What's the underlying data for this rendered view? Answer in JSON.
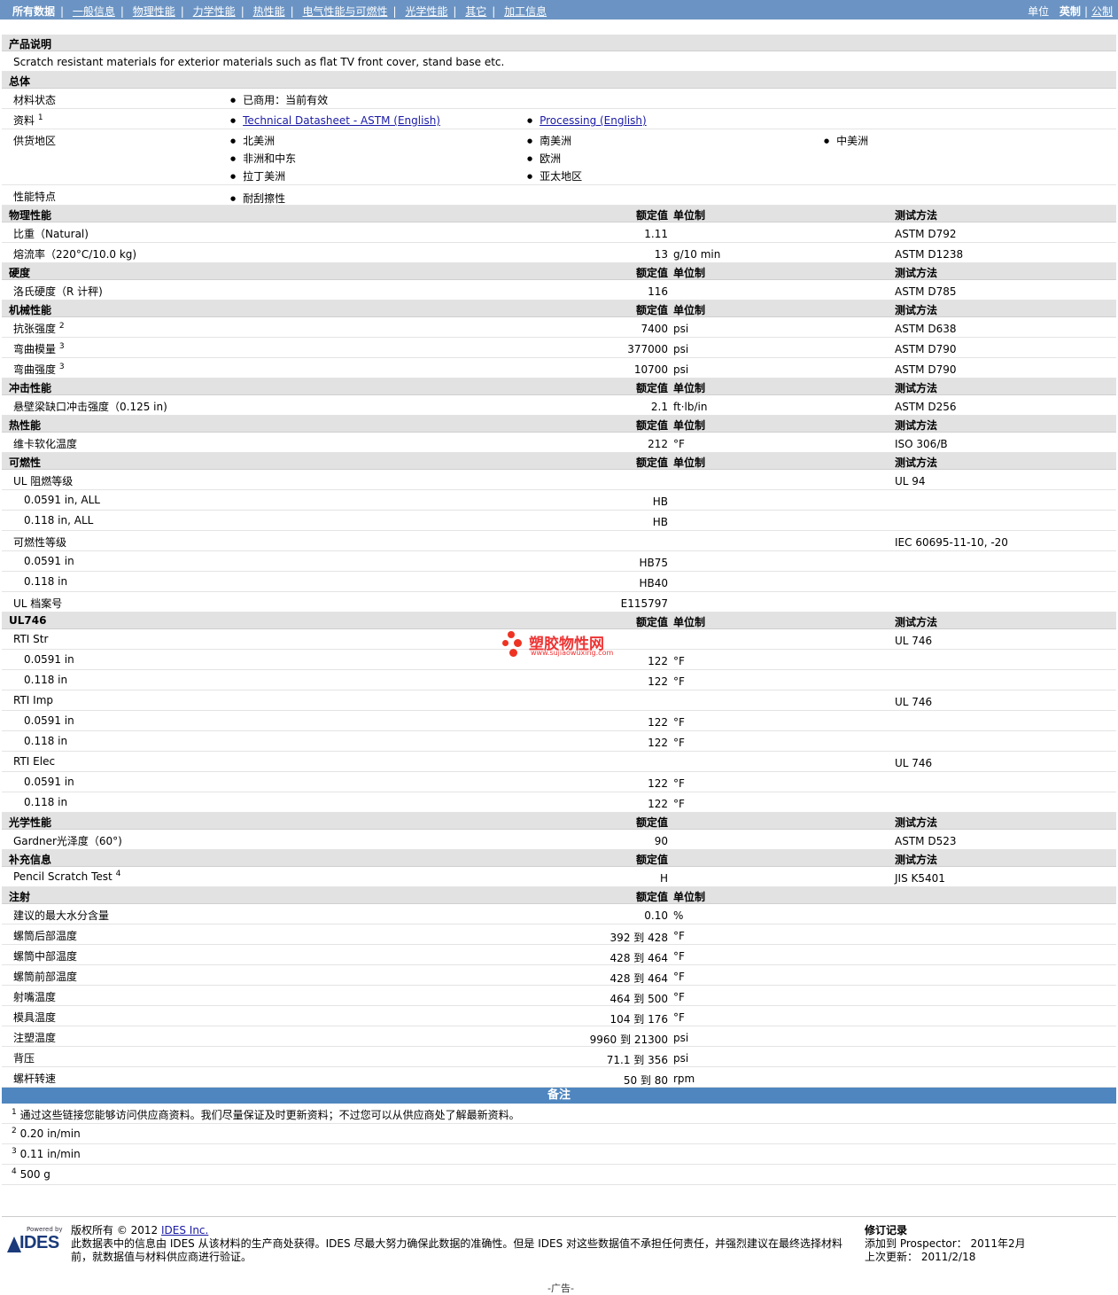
{
  "nav": {
    "tabs": [
      {
        "label": "所有数据"
      },
      {
        "label": "一般信息"
      },
      {
        "label": "物理性能"
      },
      {
        "label": "力学性能"
      },
      {
        "label": "热性能"
      },
      {
        "label": "电气性能与可燃性"
      },
      {
        "label": "光学性能"
      },
      {
        "label": "其它"
      },
      {
        "label": "加工信息"
      }
    ],
    "unit_label": "单位",
    "unit_english": "英制",
    "unit_metric": "公制"
  },
  "desc": {
    "title": "产品说明",
    "text": "Scratch resistant materials for exterior materials such as flat TV front cover, stand base etc."
  },
  "general": {
    "title": "总体",
    "status_label": "材料状态",
    "status_value": "已商用：当前有效",
    "docs_label": "资料",
    "docs_sup": "1",
    "doc1": "Technical Datasheet - ASTM (English)",
    "doc2": "Processing (English)",
    "region_label": "供货地区",
    "regions": [
      "北美洲",
      "南美洲",
      "中美洲",
      "非洲和中东",
      "欧洲",
      "拉丁美洲",
      "亚太地区"
    ],
    "feature_label": "性能特点",
    "feature_value": "耐刮擦性"
  },
  "col": {
    "value": "额定值",
    "unit": "单位制",
    "method": "测试方法"
  },
  "sections": {
    "physical": {
      "title": "物理性能",
      "rows": [
        {
          "name": "比重（Natural)",
          "value": "1.11",
          "unit": "",
          "method": "ASTM D792"
        },
        {
          "name": "熔流率（220°C/10.0 kg)",
          "value": "13",
          "unit": "g/10 min",
          "method": "ASTM D1238"
        }
      ]
    },
    "hardness": {
      "title": "硬度",
      "rows": [
        {
          "name": "洛氏硬度（R 计秤)",
          "value": "116",
          "unit": "",
          "method": "ASTM D785"
        }
      ]
    },
    "mechanical": {
      "title": "机械性能",
      "rows": [
        {
          "name": "抗张强度",
          "sup": "2",
          "value": "7400",
          "unit": "psi",
          "method": "ASTM D638"
        },
        {
          "name": "弯曲模量",
          "sup": "3",
          "value": "377000",
          "unit": "psi",
          "method": "ASTM D790"
        },
        {
          "name": "弯曲强度",
          "sup": "3",
          "value": "10700",
          "unit": "psi",
          "method": "ASTM D790"
        }
      ]
    },
    "impact": {
      "title": "冲击性能",
      "rows": [
        {
          "name": "悬壁梁缺口冲击强度（0.125 in)",
          "value": "2.1",
          "unit": "ft·lb/in",
          "method": "ASTM D256"
        }
      ]
    },
    "thermal": {
      "title": "热性能",
      "rows": [
        {
          "name": "维卡软化温度",
          "value": "212",
          "unit": "°F",
          "method": "ISO 306/B"
        }
      ]
    },
    "flammability": {
      "title": "可燃性",
      "rows": [
        {
          "name": "UL 阻燃等级",
          "value": "",
          "unit": "",
          "method": "UL 94"
        },
        {
          "name": "0.0591 in, ALL",
          "sub": true,
          "value": "HB",
          "unit": "",
          "method": ""
        },
        {
          "name": "0.118 in, ALL",
          "sub": true,
          "value": "HB",
          "unit": "",
          "method": ""
        },
        {
          "name": "可燃性等级",
          "value": "",
          "unit": "",
          "method": "IEC 60695-11-10, -20"
        },
        {
          "name": "0.0591 in",
          "sub": true,
          "value": "HB75",
          "unit": "",
          "method": ""
        },
        {
          "name": "0.118 in",
          "sub": true,
          "value": "HB40",
          "unit": "",
          "method": ""
        },
        {
          "name": "UL 档案号",
          "value": "E115797",
          "unit": "",
          "method": ""
        }
      ]
    },
    "ul746": {
      "title": "UL746",
      "rows": [
        {
          "name": "RTI Str",
          "value": "",
          "unit": "",
          "method": "UL 746"
        },
        {
          "name": "0.0591 in",
          "sub": true,
          "value": "122",
          "unit": "°F",
          "method": ""
        },
        {
          "name": "0.118 in",
          "sub": true,
          "value": "122",
          "unit": "°F",
          "method": ""
        },
        {
          "name": "RTI Imp",
          "value": "",
          "unit": "",
          "method": "UL 746"
        },
        {
          "name": "0.0591 in",
          "sub": true,
          "value": "122",
          "unit": "°F",
          "method": ""
        },
        {
          "name": "0.118 in",
          "sub": true,
          "value": "122",
          "unit": "°F",
          "method": ""
        },
        {
          "name": "RTI Elec",
          "value": "",
          "unit": "",
          "method": "UL 746"
        },
        {
          "name": "0.0591 in",
          "sub": true,
          "value": "122",
          "unit": "°F",
          "method": ""
        },
        {
          "name": "0.118 in",
          "sub": true,
          "value": "122",
          "unit": "°F",
          "method": ""
        }
      ]
    },
    "optical": {
      "title": "光学性能",
      "no_unit": true,
      "rows": [
        {
          "name": "Gardner光泽度（60°)",
          "value": "90",
          "unit": "",
          "method": "ASTM D523"
        }
      ]
    },
    "extra": {
      "title": "补充信息",
      "no_unit": true,
      "rows": [
        {
          "name": "Pencil Scratch Test",
          "sup": "4",
          "value": "H",
          "unit": "",
          "method": "JIS K5401"
        }
      ]
    },
    "injection": {
      "title": "注射",
      "no_method": true,
      "rows": [
        {
          "name": "建议的最大水分含量",
          "value": "0.10",
          "unit": "%",
          "method": ""
        },
        {
          "name": "螺筒后部温度",
          "value": "392 到  428",
          "unit": "°F",
          "method": ""
        },
        {
          "name": "螺筒中部温度",
          "value": "428 到  464",
          "unit": "°F",
          "method": ""
        },
        {
          "name": "螺筒前部温度",
          "value": "428 到  464",
          "unit": "°F",
          "method": ""
        },
        {
          "name": "射嘴温度",
          "value": "464 到  500",
          "unit": "°F",
          "method": ""
        },
        {
          "name": "模具温度",
          "value": "104 到  176",
          "unit": "°F",
          "method": ""
        },
        {
          "name": "注塑温度",
          "value": "9960 到  21300",
          "unit": "psi",
          "method": ""
        },
        {
          "name": "背压",
          "value": "71.1 到  356",
          "unit": "psi",
          "method": ""
        },
        {
          "name": "螺杆转速",
          "value": "50 到  80",
          "unit": "rpm",
          "method": ""
        }
      ]
    }
  },
  "notes": {
    "title": "备注",
    "items": [
      {
        "sup": "1",
        "text": "通过这些链接您能够访问供应商资料。我们尽量保证及时更新资料；不过您可以从供应商处了解最新资料。"
      },
      {
        "sup": "2",
        "text": "0.20 in/min"
      },
      {
        "sup": "3",
        "text": "0.11 in/min"
      },
      {
        "sup": "4",
        "text": "500 g"
      }
    ]
  },
  "footer": {
    "logo_powered": "Powered by",
    "logo_text": "IDES",
    "copyright_prefix": "版权所有  © 2012 ",
    "copyright_link": "IDES Inc.",
    "disclaimer": "此数据表中的信息由  IDES 从该材料的生产商处获得。IDES 尽最大努力确保此数据的准确性。但是  IDES 对这些数据值不承担任何责任，并强烈建议在最终选择材料前，就数据值与材料供应商进行验证。",
    "rev_title": "修订记录",
    "rev_added": "添加到  Prospector：   2011年2月",
    "rev_updated": "上次更新：     2011/2/18",
    "ad": "-广告-"
  },
  "watermark": {
    "title": "塑胶物性网",
    "url": "www.sujiaowuxing.com"
  }
}
